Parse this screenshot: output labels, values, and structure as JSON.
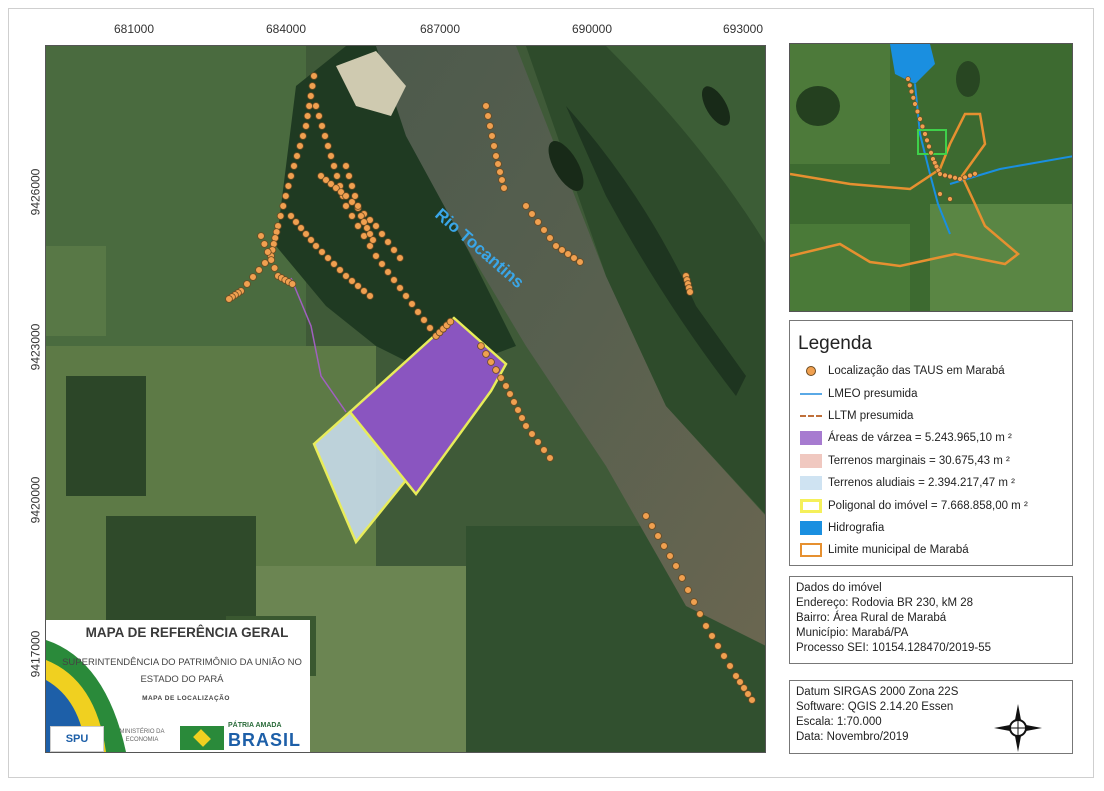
{
  "map": {
    "river_label": "Rio Tocantins",
    "x_ticks": [
      "681000",
      "684000",
      "687000",
      "690000",
      "693000"
    ],
    "y_ticks": [
      "9426000",
      "9423000",
      "9420000",
      "9417000"
    ]
  },
  "legend": {
    "title": "Legenda",
    "items": [
      {
        "label": "Localização das TAUS em Marabá",
        "symbol": "dot",
        "color": "#f0a050"
      },
      {
        "label": "LMEO presumida",
        "symbol": "line",
        "color": "#5aa9e6"
      },
      {
        "label": "LLTM presumida",
        "symbol": "dashed-line",
        "color": "#c0703a"
      },
      {
        "label": "Áreas de várzea = 5.243.965,10 m ²",
        "symbol": "fill",
        "color": "#a77bd0"
      },
      {
        "label": "Terrenos marginais = 30.675,43 m ²",
        "symbol": "fill",
        "color": "#f0c8c0"
      },
      {
        "label": "Terrenos aludiais = 2.394.217,47 m ²",
        "symbol": "fill",
        "color": "#cfe3f2"
      },
      {
        "label": "Poligonal do imóvel = 7.668.858,00 m ²",
        "symbol": "outline",
        "color": "#f5f05a"
      },
      {
        "label": "Hidrografia",
        "symbol": "fill",
        "color": "#1a8fe0"
      },
      {
        "label": "Limite municipal de Marabá",
        "symbol": "outline",
        "color": "#e69030"
      }
    ]
  },
  "property_info": {
    "lines": [
      "Dados do imóvel",
      "Endereço: Rodovia BR 230, kM 28",
      "Bairro: Área Rural de Marabá",
      "Município: Marabá/PA",
      "Processo SEI: 10154.128470/2019-55"
    ]
  },
  "map_info": {
    "lines": [
      "Datum SIRGAS 2000 Zona 22S",
      "Software: QGIS 2.14.20 Essen",
      "Escala: 1:70.000",
      "Data: Novembro/2019"
    ]
  },
  "title_panel": {
    "title": "MAPA DE REFERÊNCIA GERAL",
    "subtitle_line1": "SUPERINTENDÊNCIA DO PATRIMÔNIO DA UNIÃO NO",
    "subtitle_line2": "ESTADO DO PARÁ",
    "small": "MAPA DE LOCALIZAÇÃO",
    "logo_spu": "SPU",
    "logo_ministry": "MINISTÉRIO DA ECONOMIA",
    "logo_brasil_top": "PÁTRIA AMADA",
    "logo_brasil": "BRASIL"
  },
  "north_arrow": {
    "icon": "compass-rose-icon"
  },
  "colors": {
    "taus_dot": "#f0a050",
    "varzea": "#8a55c0",
    "aludiais": "#c8dcea",
    "polygon_outline": "#e8ec5a",
    "hydro": "#1a8fe0",
    "municipal_limit": "#e69030"
  }
}
